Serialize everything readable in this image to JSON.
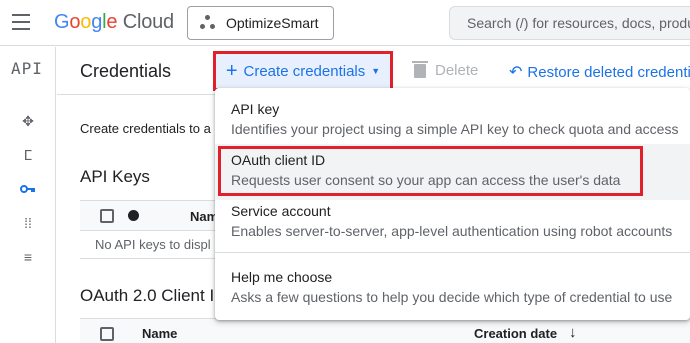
{
  "topbar": {
    "logo": {
      "g": "G",
      "o1": "o",
      "o2": "o",
      "g2": "g",
      "l": "l",
      "e": "e",
      "product": "Cloud"
    },
    "project_name": "OptimizeSmart",
    "search_placeholder": "Search (/) for resources, docs, products"
  },
  "leftnav": {
    "api_logo": "API",
    "icons": [
      "dashboard-icon",
      "library-icon",
      "credentials-key-icon",
      "oauth-consent-icon",
      "page-settings-icon"
    ]
  },
  "header": {
    "title": "Credentials",
    "create_label": "Create credentials",
    "delete_label": "Delete",
    "restore_label": "Restore deleted credentials"
  },
  "main": {
    "intro_text": "Create credentials to a",
    "api_keys_title": "API Keys",
    "api_keys_name_col": "Nam",
    "api_keys_empty": "No API keys to displ",
    "oauth_title": "OAuth 2.0 Client I",
    "oauth_name_col": "Name",
    "oauth_date_col": "Creation date",
    "sort_arrow": "↓"
  },
  "menu": {
    "items": [
      {
        "title": "API key",
        "desc": "Identifies your project using a simple API key to check quota and access"
      },
      {
        "title": "OAuth client ID",
        "desc": "Requests user consent so your app can access the user's data"
      },
      {
        "title": "Service account",
        "desc": "Enables server-to-server, app-level authentication using robot accounts"
      },
      {
        "title": "Help me choose",
        "desc": "Asks a few questions to help you decide which type of credential to use"
      }
    ]
  },
  "colors": {
    "accent": "#1a73e8",
    "highlight_border": "#e0202a",
    "disabled": "#b0b3b8"
  }
}
